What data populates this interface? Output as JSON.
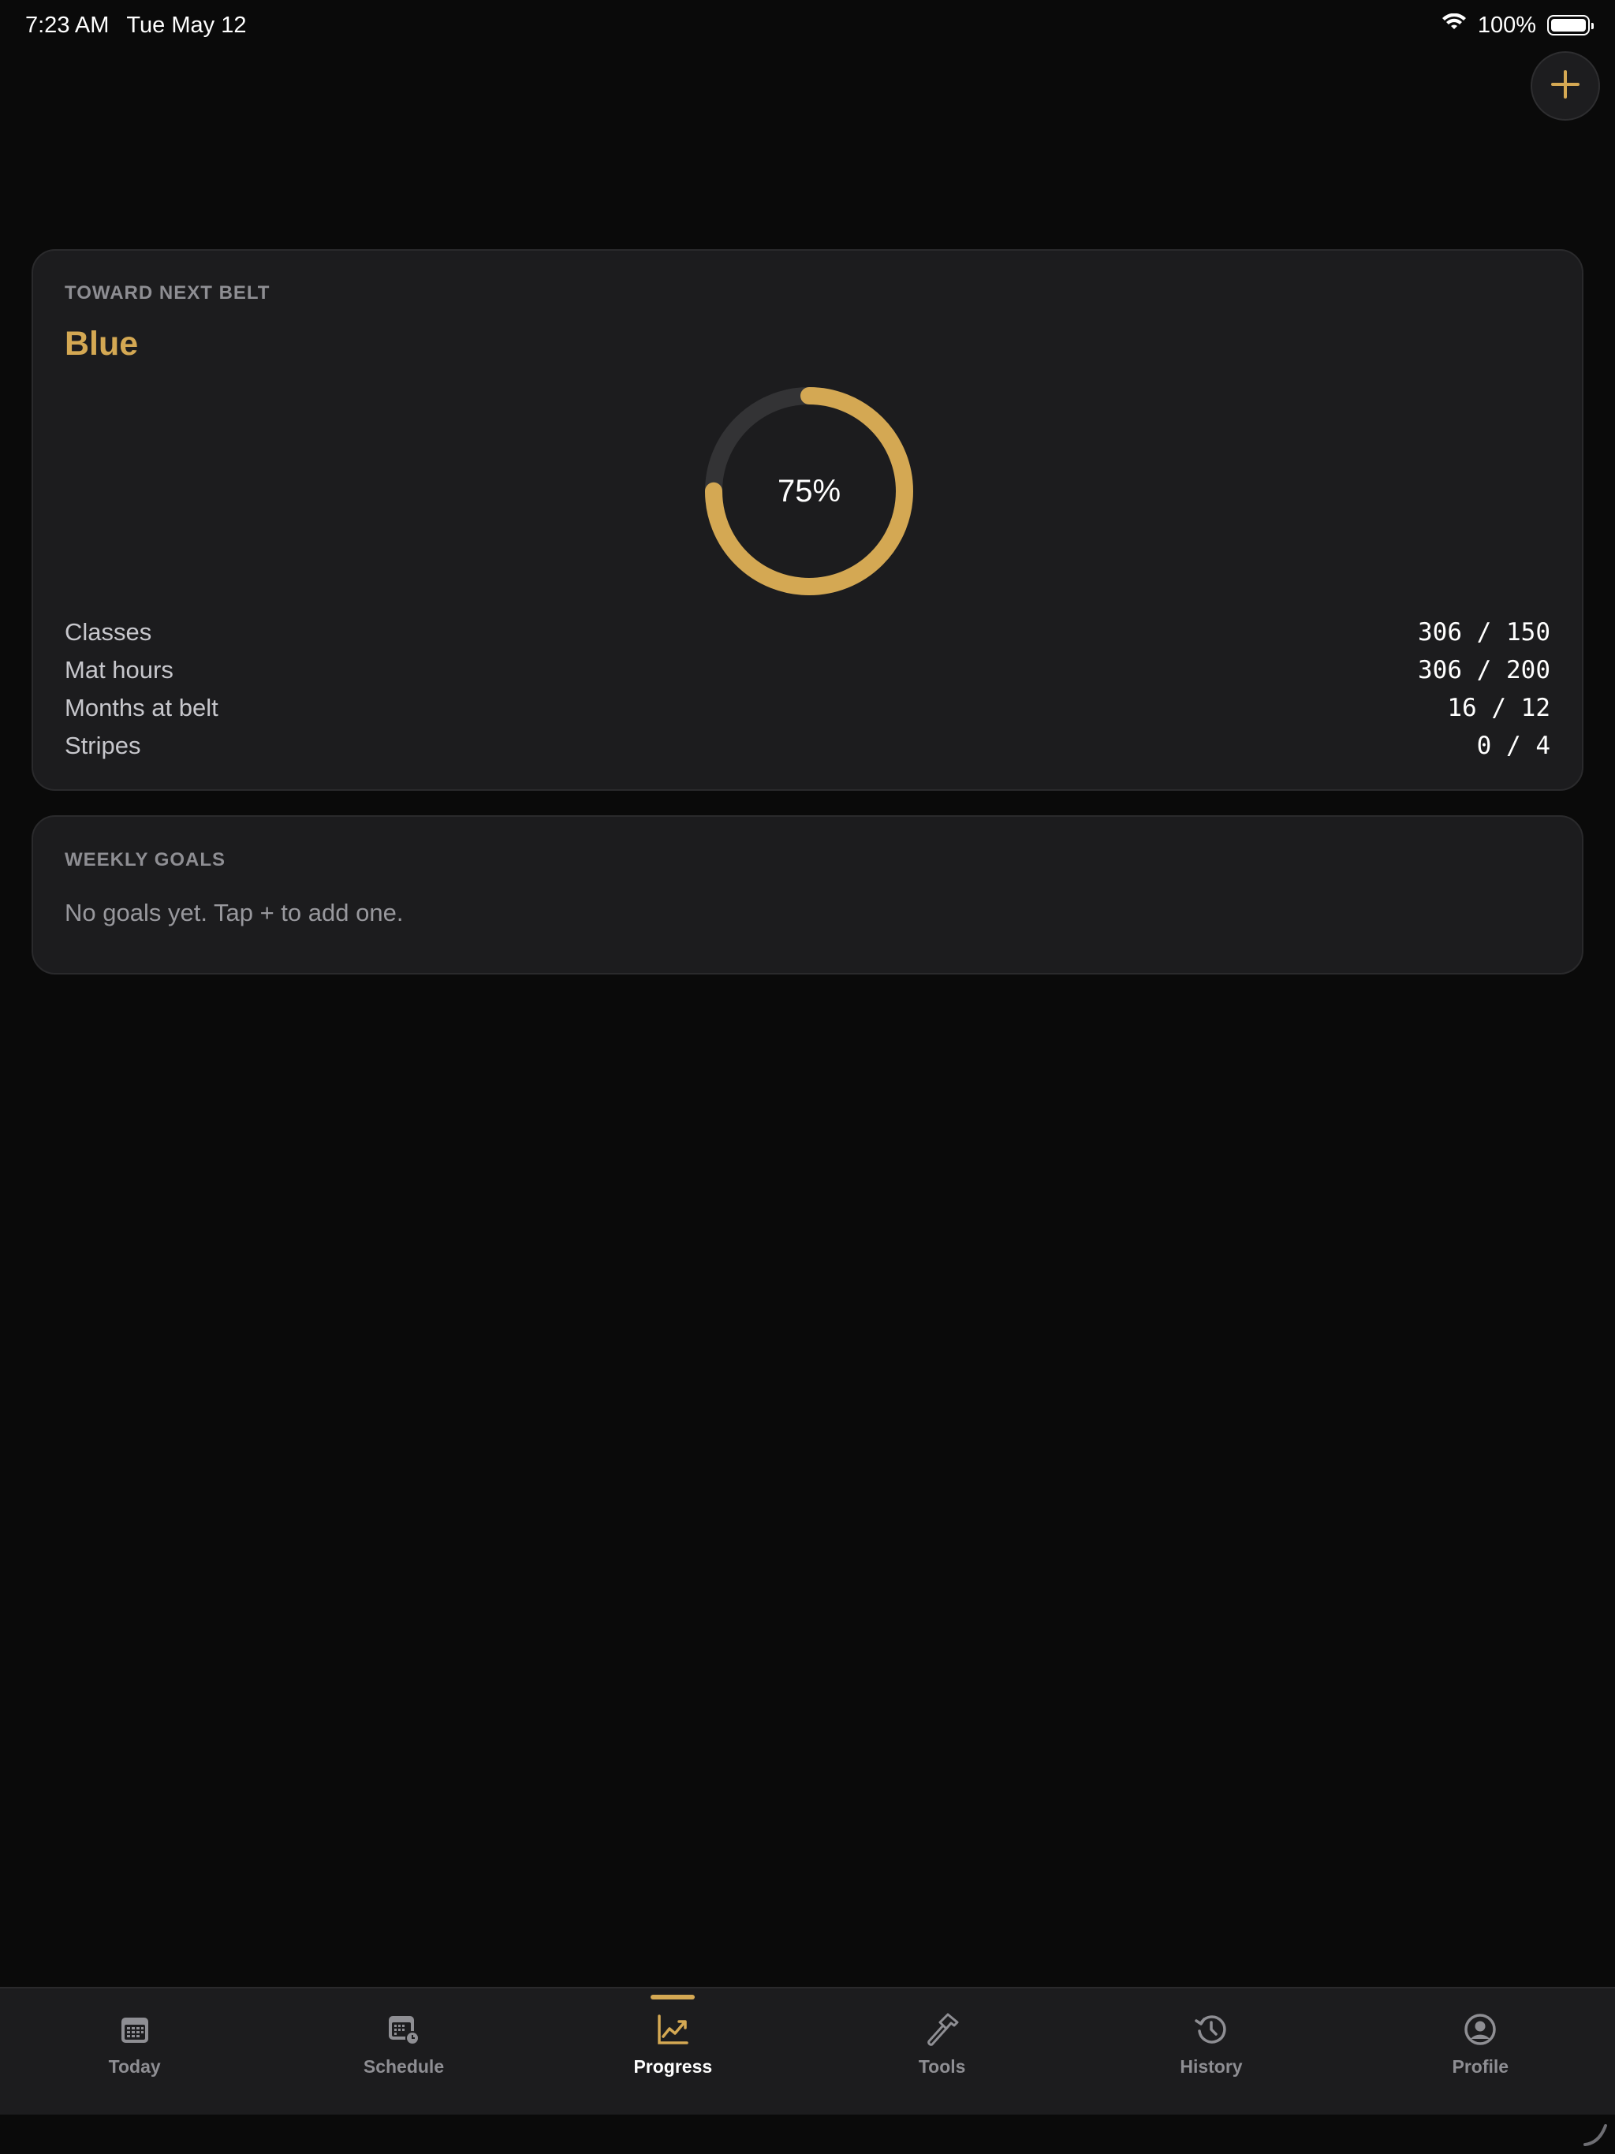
{
  "status_bar": {
    "time": "7:23 AM",
    "date": "Tue May 12",
    "battery": "100%"
  },
  "colors": {
    "accent": "#d4a853",
    "background": "#0a0a0a",
    "card": "#1c1c1e",
    "ring_track": "#333335"
  },
  "add_button": {
    "icon": "plus-icon"
  },
  "belt_card": {
    "label": "TOWARD NEXT BELT",
    "belt_name": "Blue",
    "progress_percent": 75,
    "progress_text": "75%",
    "stats": [
      {
        "label": "Classes",
        "value": "306 / 150"
      },
      {
        "label": "Mat hours",
        "value": "306 / 200"
      },
      {
        "label": "Months at belt",
        "value": " 16 / 12"
      },
      {
        "label": "Stripes",
        "value": "  0 / 4"
      }
    ]
  },
  "goals_card": {
    "label": "WEEKLY GOALS",
    "empty_text": "No goals yet. Tap + to add one."
  },
  "tabs": [
    {
      "label": "Today",
      "icon": "calendar-icon",
      "active": false
    },
    {
      "label": "Schedule",
      "icon": "calendar-clock-icon",
      "active": false
    },
    {
      "label": "Progress",
      "icon": "chart-line-icon",
      "active": true
    },
    {
      "label": "Tools",
      "icon": "hammer-icon",
      "active": false
    },
    {
      "label": "History",
      "icon": "history-icon",
      "active": false
    },
    {
      "label": "Profile",
      "icon": "profile-icon",
      "active": false
    }
  ]
}
